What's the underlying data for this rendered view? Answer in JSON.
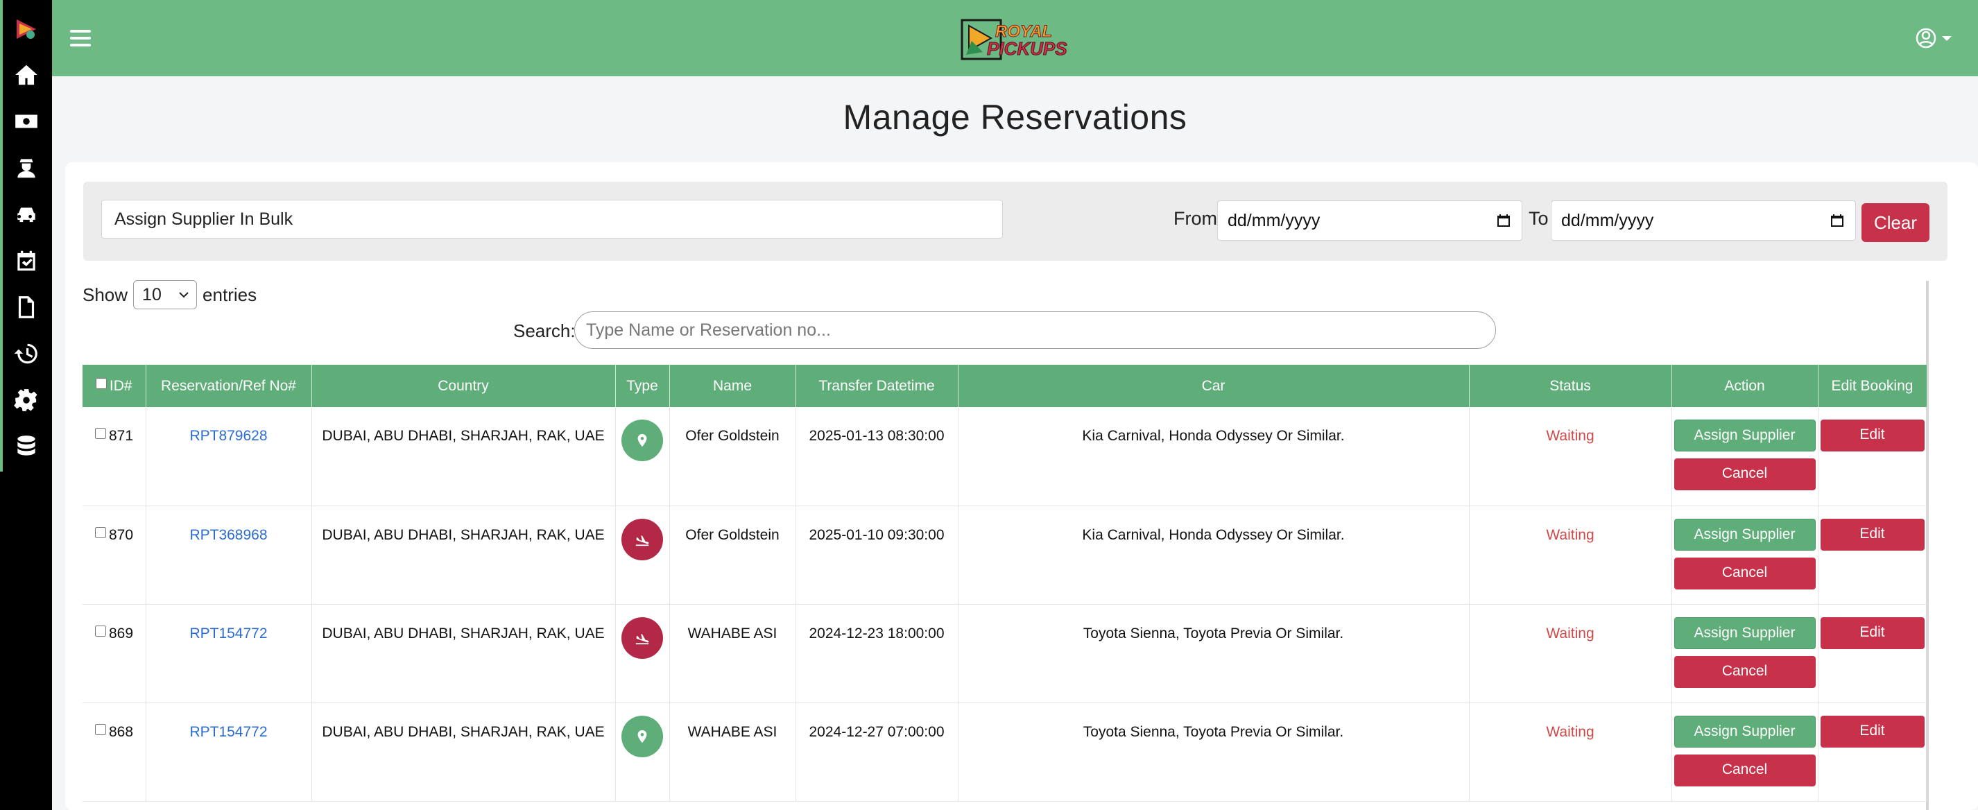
{
  "app": {
    "title": "Manage Reservations"
  },
  "colors": {
    "header": "#6dba85",
    "accent_green": "#5fae7a",
    "danger": "#c8314a",
    "link": "#2b6cd1",
    "status_waiting": "#d04848"
  },
  "sidebar": {
    "icons": [
      "home-icon",
      "money-icon",
      "driver-icon",
      "car-icon",
      "calendar-check-icon",
      "document-icon",
      "history-icon",
      "gear-icon",
      "database-icon"
    ]
  },
  "header": {
    "logo_line1": "ROYAL",
    "logo_line2": "PICKUPS"
  },
  "filters": {
    "bulk_value": "Assign Supplier In Bulk",
    "from_label": "From",
    "from_placeholder": "dd/mm/yyyy",
    "to_label": "To",
    "to_placeholder": "dd/mm/yyyy",
    "clear_label": "Clear"
  },
  "entries": {
    "show_label": "Show",
    "value": "10",
    "suffix": "entries"
  },
  "search": {
    "label": "Search:",
    "placeholder": "Type Name or Reservation no..."
  },
  "table": {
    "columns": [
      "ID#",
      "Reservation/Ref No#",
      "Country",
      "Type",
      "Name",
      "Transfer Datetime",
      "Car",
      "Status",
      "Action",
      "Edit Booking"
    ],
    "rows": [
      {
        "id": "871",
        "ref": "RPT879628",
        "country": "DUBAI, ABU DHABI, SHARJAH, RAK, UAE",
        "type": "location-pin-icon",
        "name": "Ofer Goldstein",
        "datetime": "2025-01-13 08:30:00",
        "car": "Kia Carnival, Honda Odyssey Or Similar.",
        "status": "Waiting",
        "assign": "Assign Supplier",
        "cancel": "Cancel",
        "edit": "Edit"
      },
      {
        "id": "870",
        "ref": "RPT368968",
        "country": "DUBAI, ABU DHABI, SHARJAH, RAK, UAE",
        "type": "plane-landing-icon",
        "name": "Ofer Goldstein",
        "datetime": "2025-01-10 09:30:00",
        "car": "Kia Carnival, Honda Odyssey Or Similar.",
        "status": "Waiting",
        "assign": "Assign Supplier",
        "cancel": "Cancel",
        "edit": "Edit"
      },
      {
        "id": "869",
        "ref": "RPT154772",
        "country": "DUBAI, ABU DHABI, SHARJAH, RAK, UAE",
        "type": "plane-landing-icon",
        "name": "WAHABE ASI",
        "datetime": "2024-12-23 18:00:00",
        "car": "Toyota Sienna, Toyota Previa Or Similar.",
        "status": "Waiting",
        "assign": "Assign Supplier",
        "cancel": "Cancel",
        "edit": "Edit"
      },
      {
        "id": "868",
        "ref": "RPT154772",
        "country": "DUBAI, ABU DHABI, SHARJAH, RAK, UAE",
        "type": "location-pin-icon",
        "name": "WAHABE ASI",
        "datetime": "2024-12-27 07:00:00",
        "car": "Toyota Sienna, Toyota Previa Or Similar.",
        "status": "Waiting",
        "assign": "Assign Supplier",
        "cancel": "Cancel",
        "edit": "Edit"
      }
    ]
  }
}
